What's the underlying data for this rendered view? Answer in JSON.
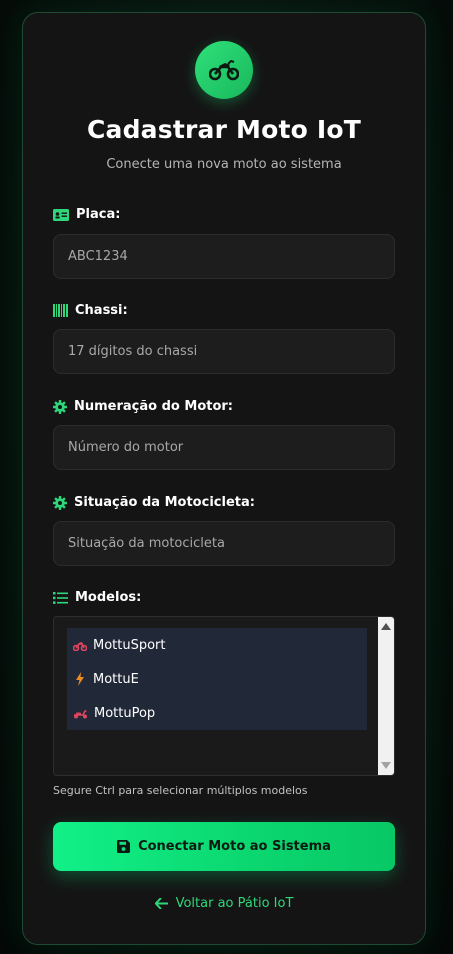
{
  "header": {
    "title": "Cadastrar Moto IoT",
    "subtitle": "Conecte uma nova moto ao sistema"
  },
  "fields": {
    "placa": {
      "label": "Placa:",
      "placeholder": "ABC1234",
      "value": ""
    },
    "chassi": {
      "label": "Chassi:",
      "placeholder": "17 dígitos do chassi",
      "value": ""
    },
    "motor": {
      "label": "Numeração do Motor:",
      "placeholder": "Número do motor",
      "value": ""
    },
    "situacao": {
      "label": "Situação da Motocicleta:",
      "placeholder": "Situação da motocicleta",
      "value": ""
    }
  },
  "modelos": {
    "label": "Modelos:",
    "options": [
      {
        "label": "MottuSport",
        "icon": "motorcycle-icon",
        "color": "#e0455e"
      },
      {
        "label": "MottuE",
        "icon": "bolt-icon",
        "color": "#f08a24"
      },
      {
        "label": "MottuPop",
        "icon": "scooter-icon",
        "color": "#e0455e"
      }
    ],
    "hint": "Segure Ctrl para selecionar múltiplos modelos"
  },
  "actions": {
    "submit_label": "Conectar Moto ao Sistema",
    "back_label": "Voltar ao Pátio IoT"
  },
  "colors": {
    "accent": "#1ee27c",
    "card_bg": "#141414",
    "input_bg": "#1d1d1d"
  }
}
